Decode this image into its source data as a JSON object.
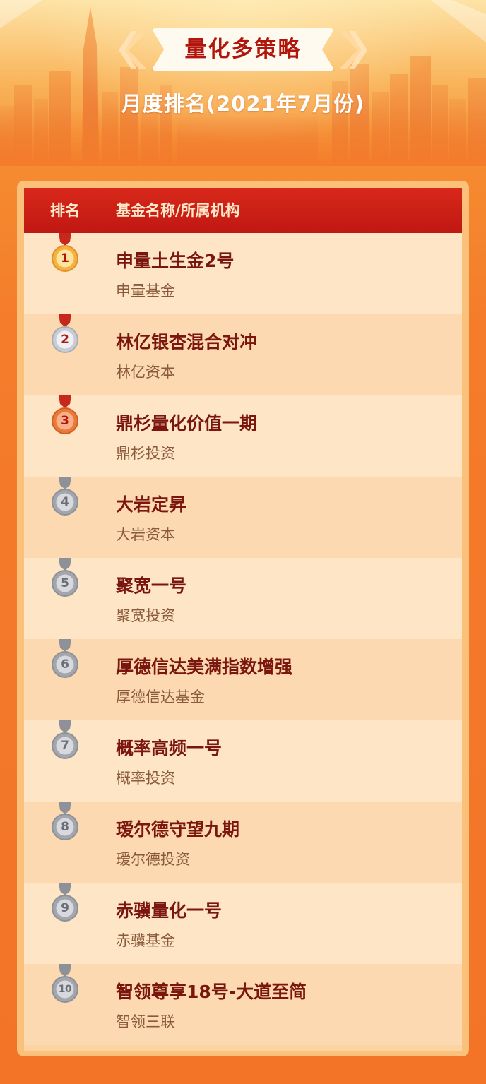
{
  "header": {
    "title": "量化多策略",
    "subtitle": "月度排名(2021年7月份)"
  },
  "table": {
    "columns": [
      "排名",
      "基金名称/所属机构"
    ],
    "rows": [
      {
        "rank": "1",
        "name": "申量土生金2号",
        "org": "申量基金",
        "medal": "gold"
      },
      {
        "rank": "2",
        "name": "林亿银杏混合对冲",
        "org": "林亿资本",
        "medal": "silver"
      },
      {
        "rank": "3",
        "name": "鼎杉量化价值一期",
        "org": "鼎杉投资",
        "medal": "bronze"
      },
      {
        "rank": "4",
        "name": "大岩定昇",
        "org": "大岩资本",
        "medal": "grey"
      },
      {
        "rank": "5",
        "name": "聚宽一号",
        "org": "聚宽投资",
        "medal": "grey"
      },
      {
        "rank": "6",
        "name": "厚德信达美满指数增强",
        "org": "厚德信达基金",
        "medal": "grey"
      },
      {
        "rank": "7",
        "name": "概率高频一号",
        "org": "概率投资",
        "medal": "grey"
      },
      {
        "rank": "8",
        "name": "瑷尔德守望九期",
        "org": "瑷尔德投资",
        "medal": "grey"
      },
      {
        "rank": "9",
        "name": "赤骥量化一号",
        "org": "赤骥基金",
        "medal": "grey"
      },
      {
        "rank": "10",
        "name": "智领尊享18号-大道至简",
        "org": "智领三联",
        "medal": "grey"
      }
    ]
  },
  "colors": {
    "accent_red": "#bf1812",
    "name_text": "#7a160e",
    "org_text": "#8a5a3c",
    "background_orange": "#f37427"
  }
}
